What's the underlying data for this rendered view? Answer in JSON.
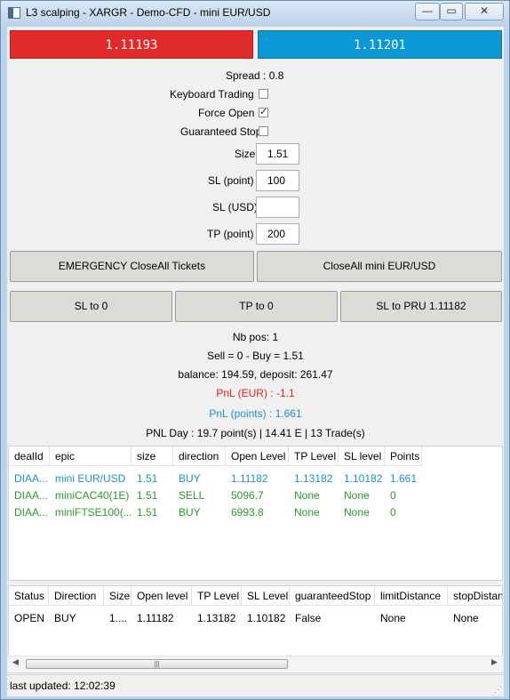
{
  "window": {
    "title": "L3 scalping - XARGR - Demo-CFD - mini EUR/USD",
    "minimize": "—",
    "maximize": "▭",
    "close": "✕"
  },
  "prices": {
    "bid": "1.11193",
    "ask": "1.11201",
    "bid_color": "#e12b2b",
    "ask_color": "#0c98d6"
  },
  "settings": {
    "spread": "Spread : 0.8",
    "keyboard_trading": {
      "label": "Keyboard Trading",
      "checked": false
    },
    "force_open": {
      "label": "Force Open",
      "checked": true
    },
    "guaranteed_stop": {
      "label": "Guaranteed Stop",
      "checked": false
    },
    "size": {
      "label": "Size",
      "value": "1.51"
    },
    "sl_point": {
      "label": "SL (point)",
      "value": "100"
    },
    "sl_usd": {
      "label": "SL (USD)",
      "value": ""
    },
    "tp_point": {
      "label": "TP (point)",
      "value": "200"
    }
  },
  "actions": {
    "emergency_close": "EMERGENCY CloseAll Tickets",
    "close_all": "CloseAll mini EUR/USD",
    "sl_to_zero": "SL to 0",
    "tp_to_zero": "TP to 0",
    "sl_to_pru": "SL to PRU 1.11182"
  },
  "summary": {
    "nb_pos": "Nb pos: 1",
    "sell_buy": "Sell = 0 - Buy = 1.51",
    "balance": "balance: 194.59, deposit: 261.47",
    "pnl_eur": "PnL (EUR) : -1.1",
    "pnl_points": "PnL (points) : 1.661",
    "pnl_day": "PNL Day : 19.7 point(s) | 14.41 E | 13 Trade(s)"
  },
  "positions": {
    "headers": [
      "dealId",
      "epic",
      "size",
      "direction",
      "Open Level",
      "TP Level",
      "SL level",
      "Points"
    ],
    "rows": [
      {
        "color": "blue",
        "cells": [
          "DIAA...",
          "mini EUR/USD",
          "1.51",
          "BUY",
          "1.11182",
          "1.13182",
          "1.10182",
          "1.661"
        ]
      },
      {
        "color": "green",
        "cells": [
          "DIAA...",
          "miniCAC40(1E)",
          "1.51",
          "SELL",
          "5096.7",
          "None",
          "None",
          "0"
        ]
      },
      {
        "color": "green",
        "cells": [
          "DIAA...",
          "miniFTSE100(...",
          "1.51",
          "BUY",
          "6993.8",
          "None",
          "None",
          "0"
        ]
      }
    ]
  },
  "orders": {
    "headers": [
      "Status",
      "Direction",
      "Size",
      "Open level",
      "TP Level",
      "SL Level",
      "guaranteedStop",
      "limitDistance",
      "stopDistan"
    ],
    "rows": [
      {
        "cells": [
          "OPEN",
          "BUY",
          "1....",
          "1.11182",
          "1.13182",
          "1.10182",
          "False",
          "None",
          "None"
        ]
      }
    ],
    "scroll_grip": "|||"
  },
  "status": {
    "last_updated": "last updated: 12:02:39"
  }
}
